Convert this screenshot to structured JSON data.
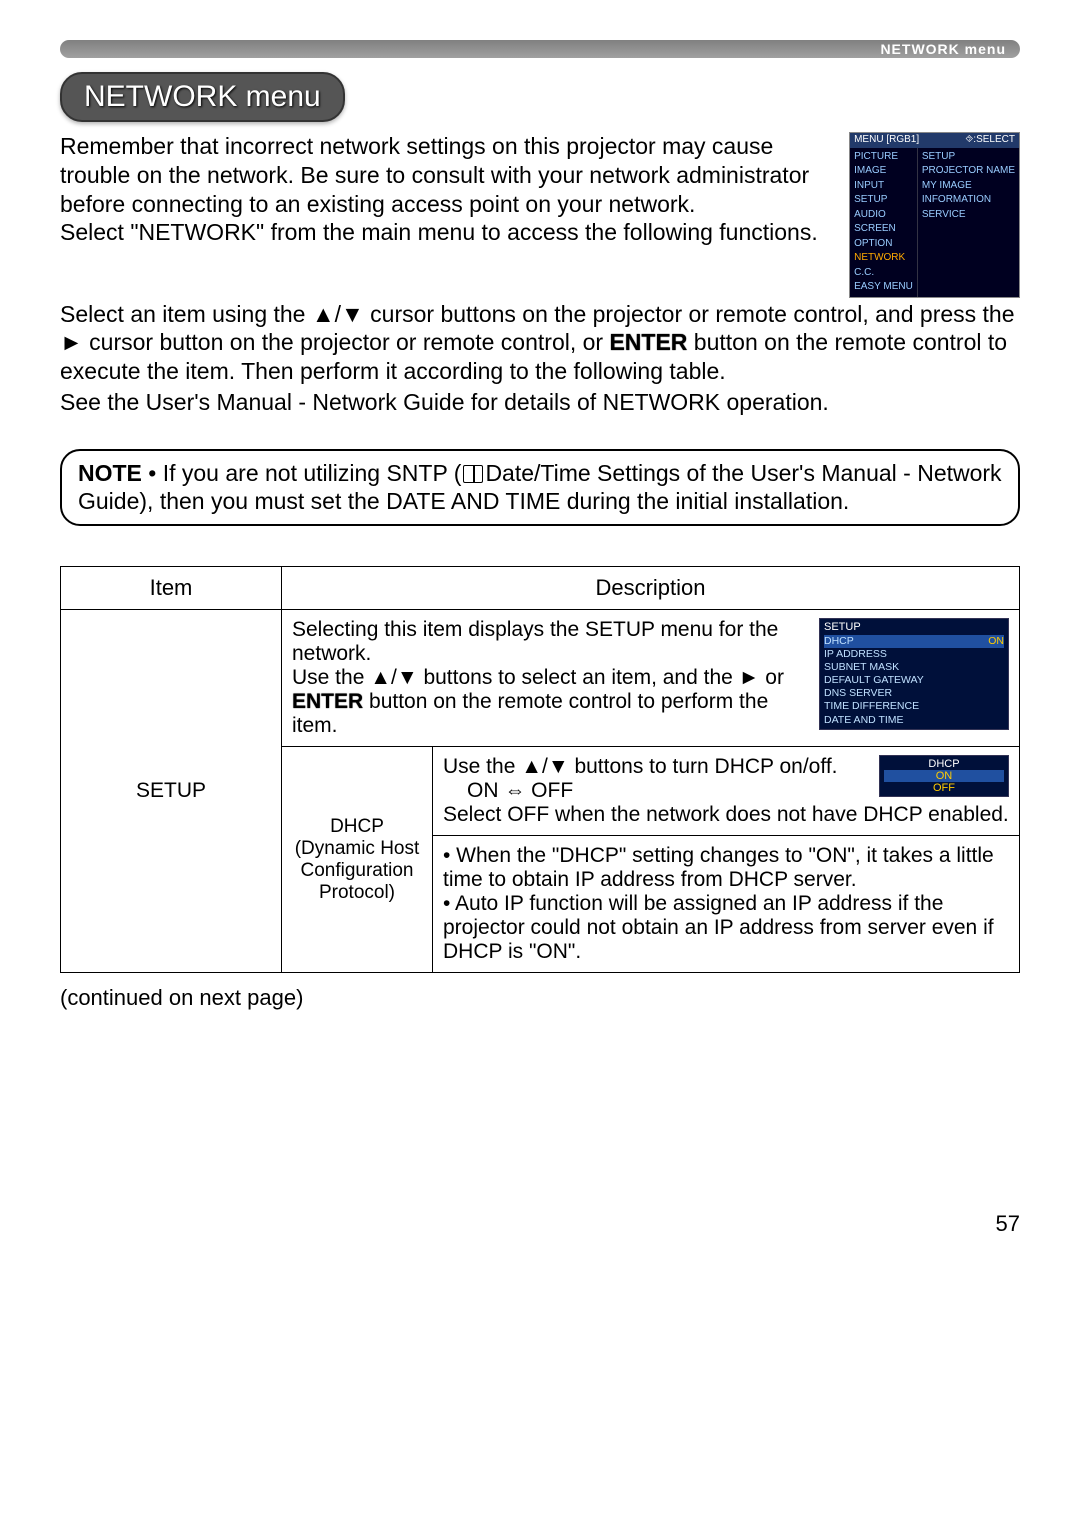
{
  "topbar": {
    "title": "NETWORK menu"
  },
  "heading": "NETWORK menu",
  "intro_p1": "Remember that incorrect network settings on this projector may cause trouble on the network. Be sure to consult with your network administrator before connecting to an existing access point on your network.",
  "intro_p2": "Select \"NETWORK\" from the main menu to access the following functions.",
  "body_p1a": "Select an item using the ▲/▼ cursor buttons on the projector or remote control, and press the ► cursor button on the projector or remote control, or ",
  "body_p1_enter": "ENTER",
  "body_p1b": " button on the remote control to execute the item. Then perform it according to the following table.",
  "body_p2": "See the User's Manual - Network Guide for details of NETWORK operation.",
  "note": {
    "label": "NOTE",
    "text_a": " • If you are not utilizing SNTP (",
    "text_b": "Date/Time Settings of the User's Manual - Network Guide), then you must set the DATE AND TIME during the initial installation."
  },
  "menu_osd": {
    "head_left": "MENU [RGB1]",
    "head_right": "⯑:SELECT",
    "left": [
      "PICTURE",
      "IMAGE",
      "INPUT",
      "SETUP",
      "AUDIO",
      "SCREEN",
      "OPTION",
      "NETWORK",
      "C.C.",
      "EASY MENU"
    ],
    "highlight_index": 7,
    "right": [
      "SETUP",
      "PROJECTOR NAME",
      "MY IMAGE",
      "INFORMATION",
      "SERVICE"
    ]
  },
  "table": {
    "head_item": "Item",
    "head_desc": "Description",
    "setup_label": "SETUP",
    "setup_desc_a": "Selecting this item displays the SETUP menu for the network.",
    "setup_desc_b": "Use the ▲/▼ buttons to select an item, and the ► or ",
    "setup_desc_enter": "ENTER",
    "setup_desc_c": " button on the remote control to perform the item.",
    "dhcp_label_1": "DHCP",
    "dhcp_label_2": "(Dynamic Host Configuration Protocol)",
    "dhcp_row1_a": "Use the ▲/▼ buttons to turn DHCP on/off.",
    "dhcp_row1_b": "ON ⇔ OFF",
    "dhcp_row1_c": "Select OFF when the network does not have DHCP enabled.",
    "dhcp_row2": "• When the \"DHCP\" setting changes to \"ON\", it takes a little time to obtain IP address from DHCP server.\n• Auto IP function will be assigned an IP address if the projector could not obtain an IP address from server even if DHCP is \"ON\"."
  },
  "setup_osd": {
    "title": "SETUP",
    "items": [
      "DHCP",
      "IP ADDRESS",
      "SUBNET MASK",
      "DEFAULT GATEWAY",
      "DNS SERVER",
      "TIME DIFFERENCE",
      "DATE AND TIME"
    ],
    "values": [
      "ON",
      "",
      "",
      "",
      "",
      "",
      ""
    ]
  },
  "dhcp_osd": {
    "title": "DHCP",
    "options": [
      "ON",
      "OFF"
    ]
  },
  "continued": "(continued on next page)",
  "page_number": "57"
}
